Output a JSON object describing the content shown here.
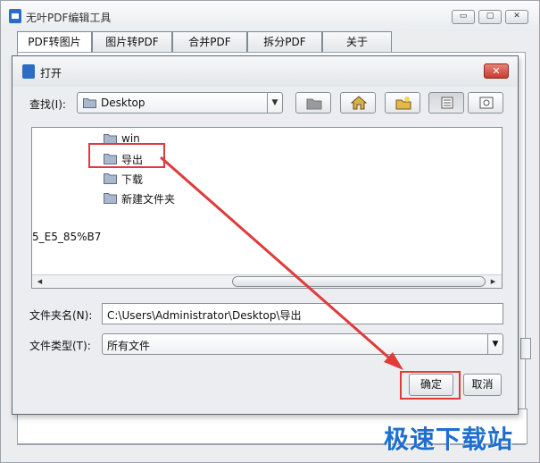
{
  "app": {
    "title": "无叶PDF编辑工具",
    "window_buttons": {
      "minimize": "▭",
      "maximize": "▢",
      "close": "✕"
    },
    "tabs": [
      {
        "label": "PDF转图片",
        "active": true
      },
      {
        "label": "图片转PDF",
        "active": false
      },
      {
        "label": "合并PDF",
        "active": false
      },
      {
        "label": "拆分PDF",
        "active": false
      },
      {
        "label": "关于",
        "active": false
      }
    ]
  },
  "dialog": {
    "title": "打开",
    "close_glyph": "✕",
    "look_in_label": "查找(I):",
    "look_in_value": "Desktop",
    "toolbar_icons": [
      "up-folder-icon",
      "home-icon",
      "new-folder-icon",
      "list-view-icon",
      "details-view-icon"
    ],
    "files": [
      {
        "name": "win",
        "icon": "folder-icon"
      },
      {
        "name": "导出",
        "icon": "folder-icon",
        "selected": true
      },
      {
        "name": "下载",
        "icon": "folder-icon"
      },
      {
        "name": "新建文件夹",
        "icon": "folder-icon"
      }
    ],
    "stray_item": "5_E5_85%B7",
    "folder_name_label": "文件夹名(N):",
    "folder_name_value": "C:\\Users\\Administrator\\Desktop\\导出",
    "file_type_label": "文件类型(T):",
    "file_type_value": "所有文件",
    "ok_label": "确定",
    "cancel_label": "取消"
  },
  "watermark": "极速下载站",
  "colors": {
    "highlight": "#e03a3a",
    "folder": "#7d93b3",
    "watermark": "#1e6fd0"
  }
}
